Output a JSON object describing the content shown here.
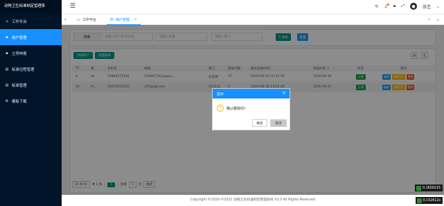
{
  "app": {
    "brand": "动物卫生标准制定管理系"
  },
  "sidebar": {
    "items": [
      {
        "label": "工作平台",
        "icon": "home-icon",
        "glyph": "⌂"
      },
      {
        "label": "用户管理",
        "icon": "user-icon",
        "glyph": "▪"
      },
      {
        "label": "立项申报",
        "icon": "doc-icon",
        "glyph": "▪"
      },
      {
        "label": "标准过程管理",
        "icon": "list-icon",
        "glyph": "▤"
      },
      {
        "label": "标准管理",
        "icon": "file-icon",
        "glyph": "▤"
      },
      {
        "label": "模板下载",
        "icon": "gear-icon",
        "glyph": "⚙"
      }
    ]
  },
  "header": {
    "username": "张艺",
    "avatar_glyph": "👤",
    "icons": [
      "refresh-icon",
      "bell-icon",
      "lock-icon",
      "fullscreen-icon"
    ]
  },
  "tabs": {
    "items": [
      {
        "label": "工作平台",
        "icon": "monitor-icon"
      },
      {
        "label": "用户管理",
        "icon": "page-icon",
        "closable": true
      }
    ]
  },
  "search": {
    "label": "搜索",
    "placeholders": [
      "请输入用户名/手机号",
      "请输入邮箱",
      "请输入部门"
    ],
    "search_button": "搜索",
    "reset_button": "重置"
  },
  "toolbar": {
    "add_user": "添加用户",
    "batch_delete": "批量删除"
  },
  "table": {
    "headers": [
      "ID",
      "用...",
      "手机号",
      "邮箱",
      "部门",
      "登录次数",
      "最近登录时间",
      "添加时间 ↕",
      "状态",
      "操作"
    ],
    "rows": [
      {
        "id": "6",
        "user": "zh...",
        "phone": "15864275181",
        "email": "250467791@qq.c...",
        "dept": "信息部",
        "logins": "17",
        "last_login": "2020-09-23 10:37:56",
        "added": "2020-09-16",
        "status": "正常"
      },
      {
        "id": "16",
        "user": "fa...",
        "phone": "15676655552",
        "email": "325@qq.com",
        "dept": "123222",
        "logins": "0",
        "last_login": "2020-09-18 13:52:26",
        "added": "2020-09-21",
        "status": "正常"
      }
    ],
    "actions": [
      {
        "label": "编辑",
        "color": "#1e9fff"
      },
      {
        "label": "查看密码",
        "color": "#ffb800"
      },
      {
        "label": "删除",
        "color": "#ff5722"
      }
    ]
  },
  "pagination": {
    "page_size": "20 条/页",
    "total": "共 2 条",
    "current": "1",
    "goto_label": "到第",
    "goto_value": "1",
    "page_unit": "页",
    "confirm": "确定"
  },
  "footer": {
    "text": "Copyright ©2020-©2022 动物卫生标准制定管理系统 V1.0 All Rights Reserved"
  },
  "modal": {
    "title": "提示",
    "message": "确认删除吗？",
    "confirm": "确定",
    "cancel": "取消"
  },
  "timings": [
    "0.1600215",
    "0.152612s"
  ]
}
